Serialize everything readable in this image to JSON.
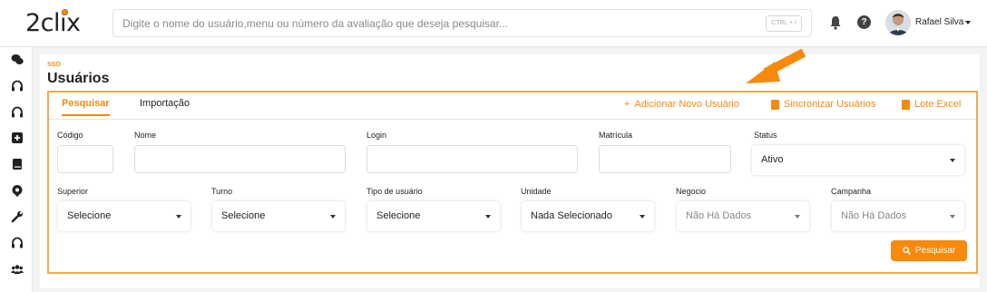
{
  "header": {
    "logo_text": "2clix",
    "search_placeholder": "Digite o nome do usuário,menu ou número da avaliação que deseja pesquisar...",
    "shortcut": "CTRL + /",
    "help_icon": "?",
    "user_name": "Rafael Silva"
  },
  "sidebar": {
    "items": [
      "chat-icon",
      "headset-icon",
      "headset-icon",
      "plus-square-icon",
      "book-icon",
      "brain-icon",
      "wrench-icon",
      "headset-icon",
      "users-icon"
    ]
  },
  "page": {
    "breadcrumb": "SSO",
    "title": "Usuários"
  },
  "tabs": [
    {
      "label": "Pesquisar",
      "active": true
    },
    {
      "label": "Importação",
      "active": false
    }
  ],
  "actions": {
    "add_user": "Adicionar Novo Usuário",
    "add_icon": "+",
    "sync_users": "Sincronizar Usuários",
    "lote_excel": "Lote Excel"
  },
  "form": {
    "codigo": {
      "label": "Código",
      "value": ""
    },
    "nome": {
      "label": "Nome",
      "value": ""
    },
    "login": {
      "label": "Login",
      "value": ""
    },
    "matricula": {
      "label": "Matrícula",
      "value": ""
    },
    "status": {
      "label": "Status",
      "value": "Ativo"
    },
    "superior": {
      "label": "Superior",
      "value": "Selecione"
    },
    "turno": {
      "label": "Turno",
      "value": "Selecione"
    },
    "tipo_usuario": {
      "label": "Tipo de usuário",
      "value": "Selecione"
    },
    "unidade": {
      "label": "Unidade",
      "value": "Nada Selecionado"
    },
    "negocio": {
      "label": "Negocio",
      "value": "Não Há Dados"
    },
    "campanha": {
      "label": "Campanha",
      "value": "Não Há Dados"
    }
  },
  "search_button": "Pesquisar",
  "colors": {
    "accent": "#f7890c",
    "panel_border": "#f7a84a"
  }
}
